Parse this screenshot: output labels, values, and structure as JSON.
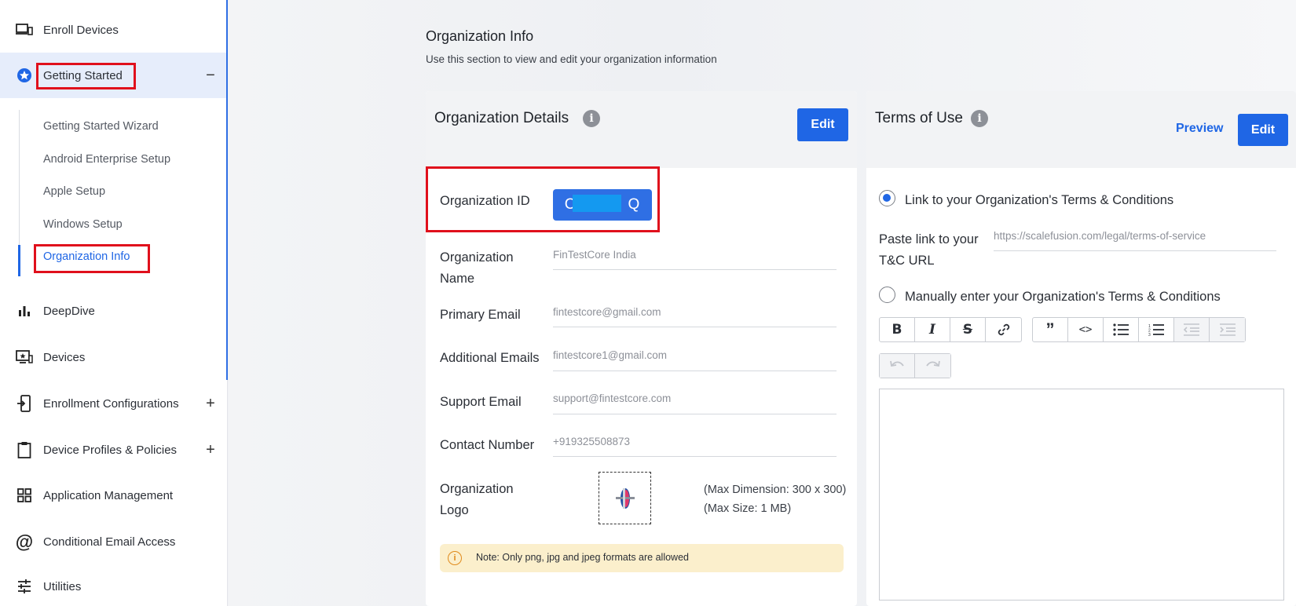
{
  "sidebar": {
    "items": [
      {
        "label": "Enroll Devices",
        "icon": "devices-icon"
      },
      {
        "label": "Getting Started",
        "icon": "star-badge-icon",
        "toggle": "−"
      },
      {
        "label": "DeepDive",
        "icon": "bar-chart-icon"
      },
      {
        "label": "Devices",
        "icon": "monitor-star-icon"
      },
      {
        "label": "Enrollment Configurations",
        "icon": "phone-enroll-icon",
        "toggle": "+"
      },
      {
        "label": "Device Profiles & Policies",
        "icon": "clipboard-icon",
        "toggle": "+"
      },
      {
        "label": "Application Management",
        "icon": "grid-icon"
      },
      {
        "label": "Conditional Email Access",
        "icon": "at-icon"
      },
      {
        "label": "Utilities",
        "icon": "sliders-icon"
      }
    ],
    "sub_items": [
      {
        "label": "Getting Started Wizard"
      },
      {
        "label": "Android Enterprise Setup"
      },
      {
        "label": "Apple Setup"
      },
      {
        "label": "Windows Setup"
      },
      {
        "label": "Organization Info"
      }
    ]
  },
  "page": {
    "title": "Organization Info",
    "subtitle": "Use this section to view and edit your organization information"
  },
  "org_details": {
    "title": "Organization Details",
    "edit_label": "Edit",
    "org_id_label": "Organization ID",
    "org_id_value_left": "C",
    "org_id_value_right": "Q",
    "fields": [
      {
        "label_line1": "Organization",
        "label_line2": "Name",
        "value": "FinTestCore India"
      },
      {
        "label_line1": "Primary Email",
        "value": "fintestcore@gmail.com"
      },
      {
        "label_line1": "Additional Emails",
        "value": "fintestcore1@gmail.com"
      },
      {
        "label_line1": "Support Email",
        "value": "support@fintestcore.com"
      },
      {
        "label_line1": "Contact Number",
        "value": "+919325508873"
      }
    ],
    "logo_label_line1": "Organization",
    "logo_label_line2": "Logo",
    "logo_hint_1": "(Max Dimension: 300 x 300)",
    "logo_hint_2": "(Max Size: 1 MB)",
    "note": "Note: Only png, jpg and jpeg formats are allowed"
  },
  "terms": {
    "title": "Terms of Use",
    "preview_label": "Preview",
    "edit_label": "Edit",
    "option_link": "Link to your Organization's Terms & Conditions",
    "paste_label_line1": "Paste link to your",
    "paste_label_line2": "T&C URL",
    "url_value": "https://scalefusion.com/legal/terms-of-service",
    "option_manual": "Manually enter your Organization's Terms & Conditions",
    "link_selected": true
  },
  "colors": {
    "accent": "#1f66e5",
    "highlight_box": "#e0101c",
    "note_bg": "#fbefcc"
  }
}
